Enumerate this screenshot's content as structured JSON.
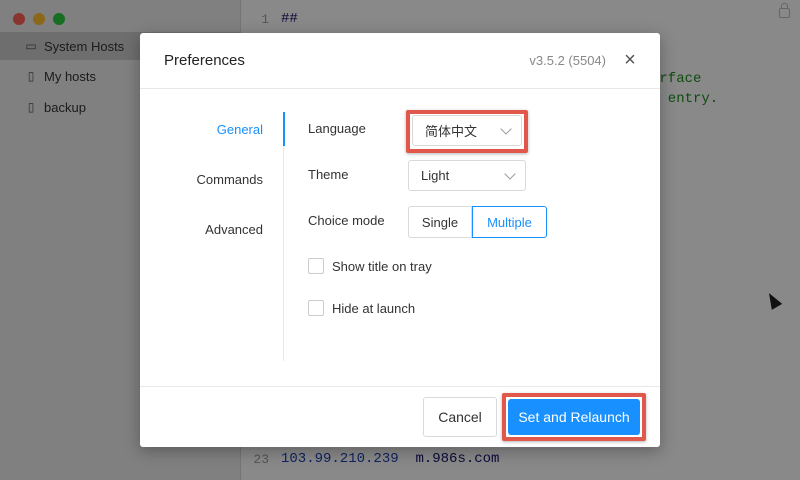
{
  "sidebar": {
    "items": [
      {
        "label": "System Hosts",
        "icon": "monitor-icon"
      },
      {
        "label": "My hosts",
        "icon": "file-icon"
      },
      {
        "label": "backup",
        "icon": "file-icon"
      }
    ]
  },
  "editor": {
    "lines": [
      {
        "num": "1",
        "text": "##"
      },
      {
        "num": "23",
        "ip": "103.99.210.239",
        "host": "m.986s.com"
      }
    ],
    "visible_comments": [
      "erface",
      "s entry."
    ]
  },
  "dialog": {
    "title": "Preferences",
    "version": "v3.5.2 (5504)",
    "close_symbol": "×",
    "tabs": [
      "General",
      "Commands",
      "Advanced"
    ],
    "active_tab": "General",
    "language": {
      "label": "Language",
      "value": "简体中文"
    },
    "theme": {
      "label": "Theme",
      "value": "Light"
    },
    "choice_mode": {
      "label": "Choice mode",
      "options": [
        "Single",
        "Multiple"
      ],
      "selected": "Multiple"
    },
    "show_title_on_tray": {
      "label": "Show title on tray",
      "checked": false
    },
    "hide_at_launch": {
      "label": "Hide at launch",
      "checked": false
    },
    "cancel_label": "Cancel",
    "confirm_label": "Set and Relaunch"
  },
  "colors": {
    "accent": "#1890ff",
    "highlight": "#e0574b",
    "comment": "#1a8b1a"
  }
}
